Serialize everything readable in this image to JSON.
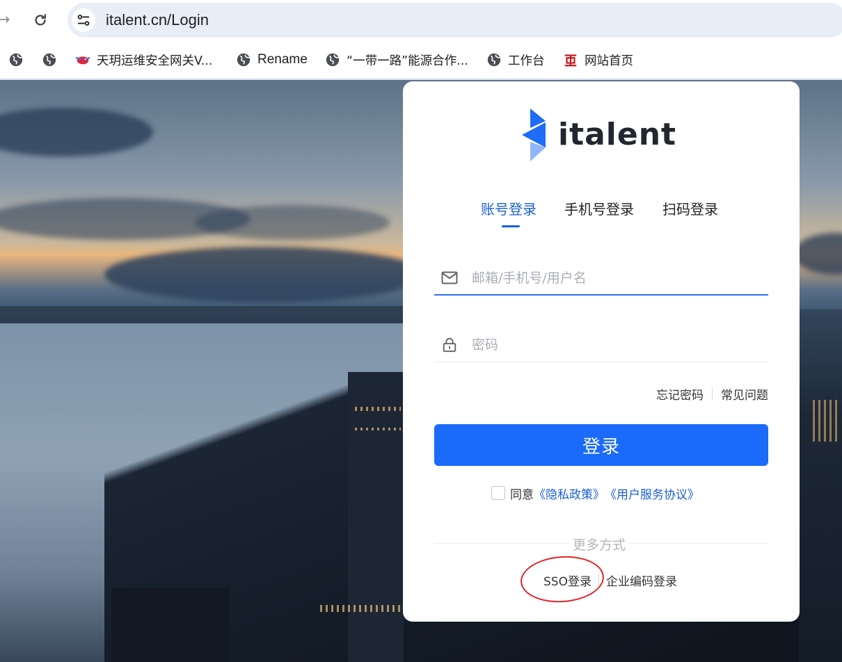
{
  "browser": {
    "nav_forward_icon": "arrow-right-icon",
    "reload_icon": "reload-icon",
    "site_info_icon": "tune-icon",
    "url": "italent.cn/Login"
  },
  "bookmarks": [
    {
      "label": "",
      "icon": "globe-icon"
    },
    {
      "label": "",
      "icon": "globe-icon"
    },
    {
      "label": "天玥运维安全网关V...",
      "icon": "bird-logo-icon"
    },
    {
      "label": "Rename",
      "icon": "globe-icon"
    },
    {
      "label": "“一带一路”能源合作...",
      "icon": "globe-icon"
    },
    {
      "label": "工作台",
      "icon": "globe-icon"
    },
    {
      "label": "网站首页",
      "icon": "red-emblem-icon"
    }
  ],
  "login": {
    "logo_text": "italent",
    "tabs": [
      {
        "label": "账号登录",
        "active": true
      },
      {
        "label": "手机号登录",
        "active": false
      },
      {
        "label": "扫码登录",
        "active": false
      }
    ],
    "username": {
      "placeholder": "邮箱/手机号/用户名",
      "value": ""
    },
    "password": {
      "placeholder": "密码",
      "value": ""
    },
    "forgot_password": "忘记密码",
    "faq": "常见问题",
    "submit_label": "登录",
    "agree_prefix": "同意",
    "privacy_policy": "《隐私政策》",
    "user_agreement": "《用户服务协议》",
    "agree_checked": false,
    "more_methods": "更多方式",
    "sso_login": "SSO登录",
    "enterprise_code_login": "企业编码登录"
  },
  "colors": {
    "accent": "#1a6bfa",
    "link": "#1a5fd6",
    "annotation": "#e02424"
  }
}
